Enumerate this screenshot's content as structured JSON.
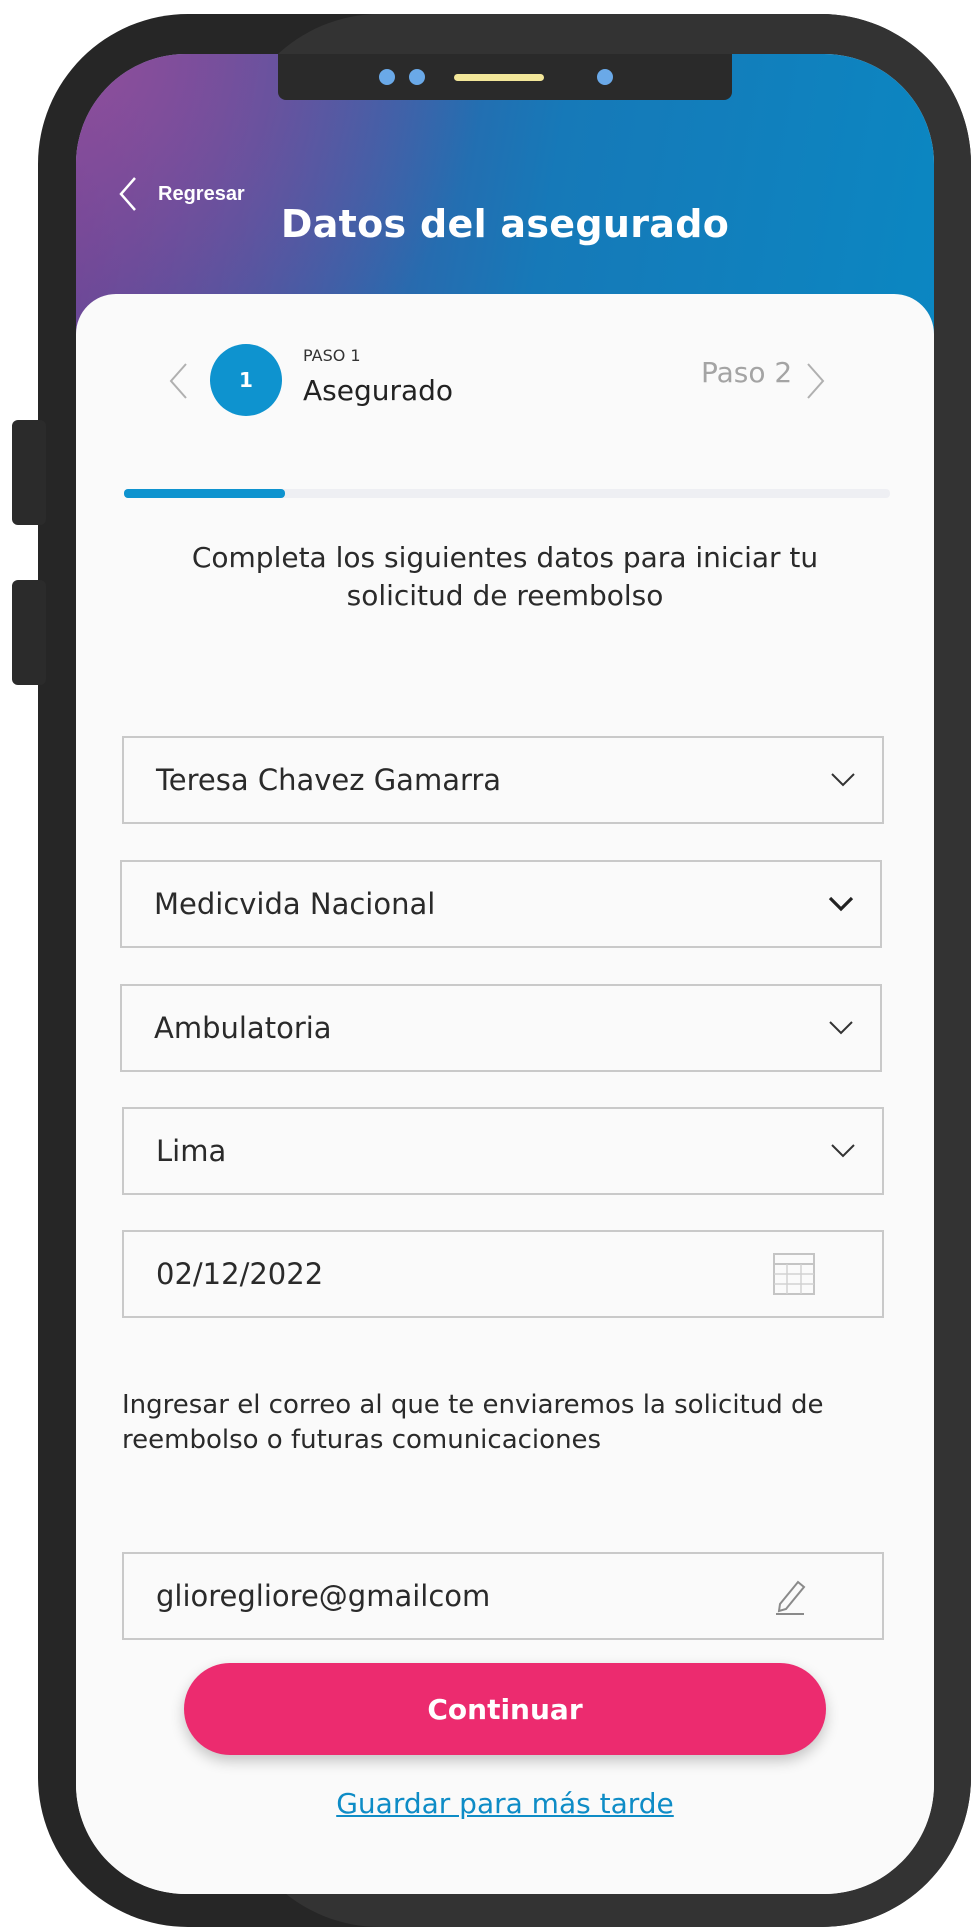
{
  "header": {
    "back_label": "Regresar",
    "title": "Datos del asegurado"
  },
  "stepper": {
    "current_number": "1",
    "current_caption": "PASO 1",
    "current_label": "Asegurado",
    "next_label": "Paso 2",
    "progress_fraction": 0.21
  },
  "form": {
    "intro": "Completa los siguientes datos para iniciar tu solicitud de reembolso",
    "insured": "Teresa Chavez Gamarra",
    "plan": "Medicvida Nacional",
    "care_type": "Ambulatoria",
    "city": "Lima",
    "date": "02/12/2022",
    "email_label": "Ingresar el correo al que te enviaremos la solicitud de reembolso o futuras comunicaciones",
    "email": "glioregliore@gmailcom"
  },
  "actions": {
    "continue_label": "Continuar",
    "save_later_label": "Guardar para más tarde"
  },
  "colors": {
    "accent_blue": "#0e93cf",
    "primary_button": "#ec2b6f",
    "link": "#0e8cc6"
  },
  "icons": [
    "chevron-left-icon",
    "chevron-right-icon",
    "chevron-down-icon",
    "calendar-icon",
    "pencil-icon"
  ]
}
